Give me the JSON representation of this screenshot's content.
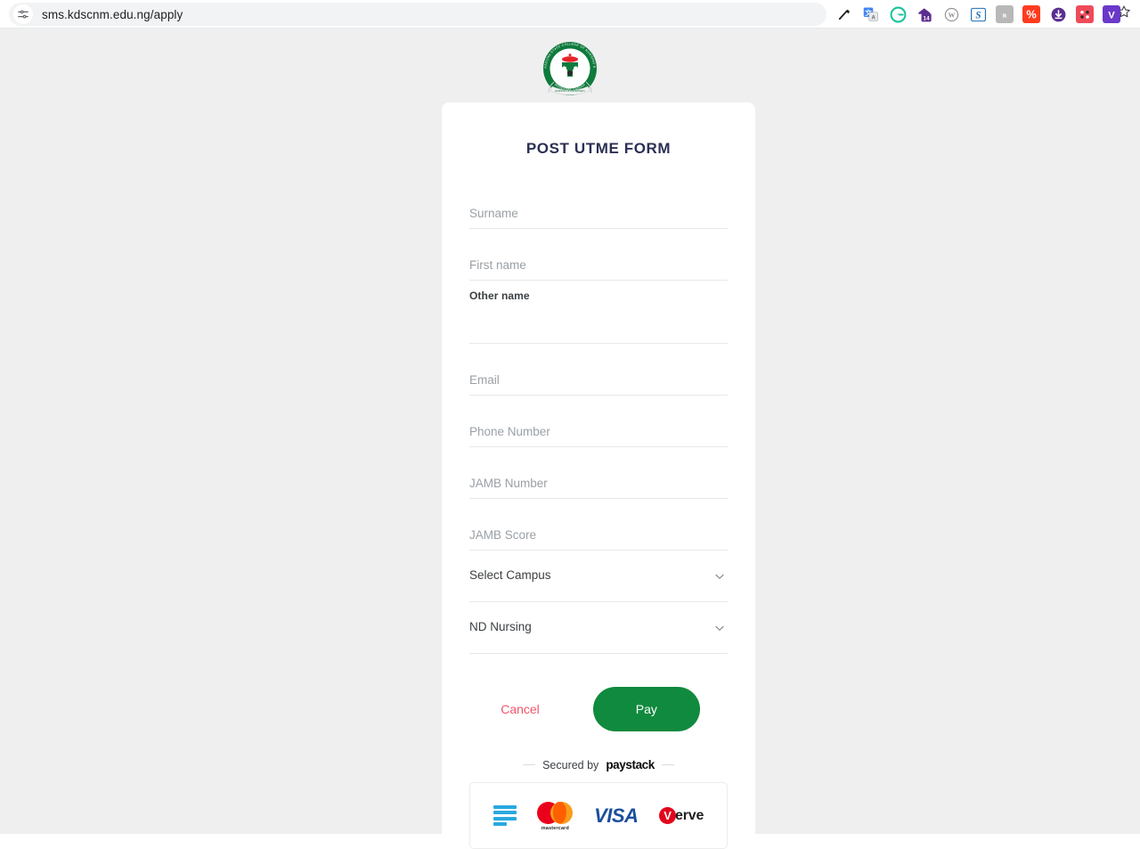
{
  "browser": {
    "url": "sms.kdscnm.edu.ng/apply",
    "site_settings_icon": "tune-sliders-icon",
    "bookmark_icon": "star-outline-icon",
    "extensions": [
      {
        "name": "eyedropper-extension-icon",
        "label": "",
        "bg": "#ffffff",
        "fg": "#1c1c1c"
      },
      {
        "name": "google-translate-extension-icon",
        "label": "文",
        "bg": "#4285f4",
        "fg": "#ffffff"
      },
      {
        "name": "grammarly-extension-icon",
        "label": "G",
        "bg": "#15c39a",
        "fg": "#ffffff"
      },
      {
        "name": "calendar-extension-icon",
        "label": "14",
        "bg": "#5b2d90",
        "fg": "#ffffff"
      },
      {
        "name": "wordpress-extension-icon",
        "label": "W",
        "bg": "#8f8f8f",
        "fg": "#ffffff"
      },
      {
        "name": "scribe-extension-icon",
        "label": "S",
        "bg": "#ffffff",
        "fg": "#1d6fb8"
      },
      {
        "name": "unknown-gray-extension-icon",
        "label": "R",
        "bg": "#b8b8b8",
        "fg": "#ffffff"
      },
      {
        "name": "percent-extension-icon",
        "label": "%",
        "bg": "#ff3b1f",
        "fg": "#ffffff"
      },
      {
        "name": "download-extension-icon",
        "label": "↓",
        "bg": "#5b2d90",
        "fg": "#ffffff"
      },
      {
        "name": "dots-red-extension-icon",
        "label": "∷",
        "bg": "#f04a5a",
        "fg": "#ffffff"
      },
      {
        "name": "v-purple-extension-icon",
        "label": "V",
        "bg": "#6a39c9",
        "fg": "#ffffff"
      }
    ]
  },
  "logo": {
    "alt": "Kaduna State College of Nursing & Midwifery seal",
    "ring_text_top": "KADUNA STATE COLLEGE OF NURSING &",
    "ring_text_bottom": "MIDWIFERY, KADUNA",
    "colors": {
      "ring": "#0e7a3c",
      "accent": "#e8232a"
    }
  },
  "form": {
    "title": "POST UTME FORM",
    "fields": [
      {
        "name": "surname",
        "label": "Surname",
        "placeholder": "Surname",
        "value": "",
        "state": "placeholder"
      },
      {
        "name": "first-name",
        "label": "First name",
        "placeholder": "First name",
        "value": "",
        "state": "placeholder"
      },
      {
        "name": "other-name",
        "label": "Other name",
        "placeholder": "",
        "value": "",
        "state": "floated"
      },
      {
        "name": "email",
        "label": "Email",
        "placeholder": "Email",
        "value": "",
        "state": "placeholder"
      },
      {
        "name": "phone-number",
        "label": "Phone Number",
        "placeholder": "Phone Number",
        "value": "",
        "state": "placeholder"
      },
      {
        "name": "jamb-number",
        "label": "JAMB Number",
        "placeholder": "JAMB Number",
        "value": "",
        "state": "placeholder"
      },
      {
        "name": "jamb-score",
        "label": "JAMB Score",
        "placeholder": "JAMB Score",
        "value": "",
        "state": "placeholder"
      }
    ],
    "selects": [
      {
        "name": "campus",
        "value": "Select Campus",
        "icon": "chevron-down-icon"
      },
      {
        "name": "programme",
        "value": "ND Nursing",
        "icon": "chevron-down-icon"
      }
    ],
    "cancel_label": "Cancel",
    "pay_label": "Pay",
    "cancel_color": "#f2556b",
    "pay_color": "#108a3e"
  },
  "footer": {
    "secured_prefix": "Secured by",
    "secured_brand": "paystack",
    "cards": [
      {
        "name": "bank-transfer-logo",
        "label": ""
      },
      {
        "name": "mastercard-logo",
        "label": "mastercard"
      },
      {
        "name": "visa-logo",
        "label": "VISA"
      },
      {
        "name": "verve-logo",
        "label_v": "V",
        "label_rest": "erve"
      }
    ]
  }
}
